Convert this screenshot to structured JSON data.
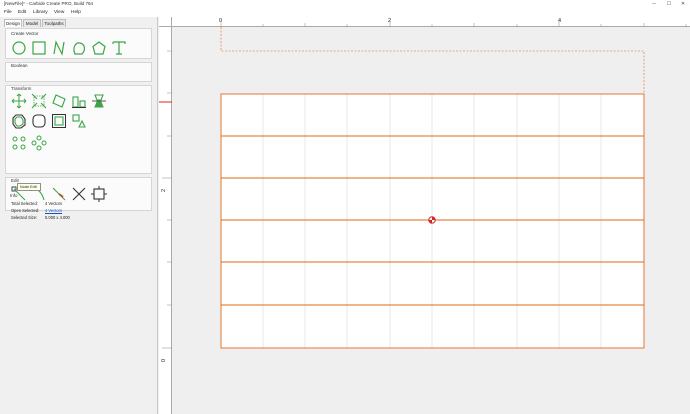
{
  "window": {
    "title": "[NewFile]* - Carbide Create PRO, Build 764",
    "minimize": "─",
    "maximize": "☐",
    "close": "✕"
  },
  "menu": [
    "File",
    "Edit",
    "Library",
    "View",
    "Help"
  ],
  "tabs": [
    "Design",
    "Model",
    "Toolpaths"
  ],
  "sections": {
    "create_vector": "Create Vector",
    "boolean": "Boolean",
    "transform": "Transform",
    "edit": "Edit",
    "info": "Info"
  },
  "tooltip": "Node Edit",
  "info": {
    "total_selected_label": "Total Selected:",
    "total_selected_value": "4 Vectors",
    "open_selected_label": "Open Selected:",
    "open_selected_value": "4 Vectors",
    "selected_size_label": "Selected Size:",
    "selected_size_value": "5.000 x 4.000"
  },
  "ruler": {
    "top_labels": [
      "0",
      "2",
      "4"
    ],
    "left_labels": [
      "2",
      "0"
    ]
  },
  "colors": {
    "accent_green": "#3aa645",
    "vector_orange": "#e06a1a",
    "grid": "#cfcfcf"
  },
  "icons": {
    "create_vector": [
      "circle-icon",
      "rectangle-icon",
      "polyline-icon",
      "curve-icon",
      "polygon-icon",
      "text-icon"
    ],
    "transform": [
      "move-icon",
      "scale-icon",
      "rotate-icon",
      "align-icon",
      "mirror-icon",
      "offset-icon",
      "fillet-icon",
      "boundary-box-icon",
      "trim-icon",
      "linear-array-icon",
      "circular-array-icon"
    ],
    "edit": [
      "node-edit-icon",
      "smooth-curve-icon",
      "cut-curve-icon",
      "delete-node-icon",
      "join-icon"
    ]
  }
}
